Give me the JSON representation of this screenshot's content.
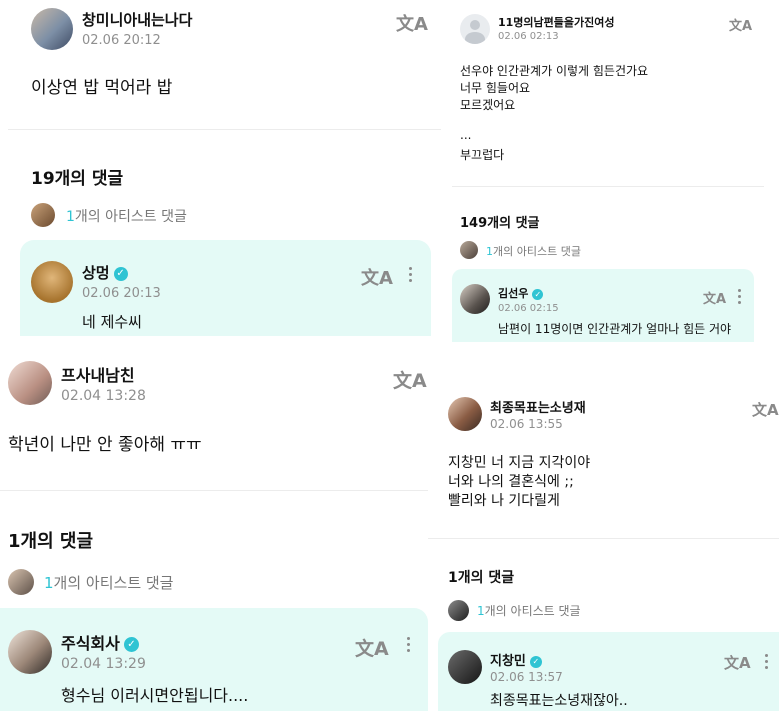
{
  "panel1": {
    "post": {
      "author": "창미니아내는나다",
      "time": "02.06 20:12",
      "body": "이상연 밥 먹어라 밥"
    },
    "comments": {
      "count_label": "19개의 댓글",
      "artist_count": "1",
      "artist_label": "개의 아티스트 댓글"
    },
    "reply": {
      "author": "상멍",
      "time": "02.06 20:13",
      "body": "네 제수씨"
    }
  },
  "panel2": {
    "post": {
      "author": "프사내남친",
      "time": "02.04 13:28",
      "body": "학년이 나만 안 좋아해 ㅠㅠ"
    },
    "comments": {
      "count_label": "1개의 댓글",
      "artist_count": "1",
      "artist_label": "개의 아티스트 댓글"
    },
    "reply": {
      "author": "주식회사",
      "time": "02.04 13:29",
      "body": "형수님 이러시면안됩니다...."
    }
  },
  "panel3": {
    "post": {
      "author": "11명의남편들을가진여성",
      "time": "02.06 02:13",
      "lines": [
        "선우야 인간관계가 이렇게 힘든건가요",
        "너무 힘들어요",
        "모르겠어요",
        "",
        "...",
        "부끄럽다"
      ]
    },
    "comments": {
      "count_label": "149개의 댓글",
      "artist_count": "1",
      "artist_label": "개의 아티스트 댓글"
    },
    "reply": {
      "author": "김선우",
      "time": "02.06 02:15",
      "body": "남편이 11명이면 인간관계가 얼마나 힘든 거야"
    }
  },
  "panel4": {
    "post": {
      "author": "최종목표는소녕재",
      "time": "02.06 13:55",
      "lines": [
        "지창민 너 지금 지각이야",
        "너와 나의 결혼식에 ;;",
        "빨리와 나 기다릴게"
      ]
    },
    "comments": {
      "count_label": "1개의 댓글",
      "artist_count": "1",
      "artist_label": "개의 아티스트 댓글"
    },
    "reply": {
      "author": "지창민",
      "time": "02.06 13:57",
      "body": "최종목표는소녕재잖아.."
    }
  },
  "icons": {
    "translate": "translate-icon",
    "more": "more-vertical-icon",
    "verified": "verified-badge-icon",
    "default_avatar": "default-avatar-icon"
  },
  "colors": {
    "bubble": "#e4faf6",
    "accent": "#2fc4d3",
    "timestamp": "#8f8f8f"
  }
}
